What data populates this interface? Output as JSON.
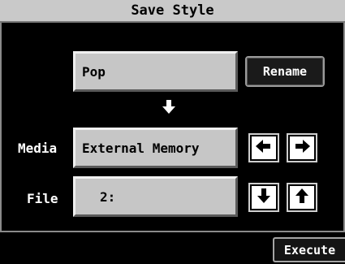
{
  "header": {
    "title": "Save Style"
  },
  "style_name": {
    "value": "Pop"
  },
  "rename_button": {
    "label": "Rename"
  },
  "media": {
    "label": "Media",
    "value": "External Memory"
  },
  "file": {
    "label": "File",
    "value": "2:"
  },
  "footer": {
    "execute_label": "Execute"
  },
  "icons": {
    "down_indicator": "arrow-down",
    "media_prev": "arrow-left",
    "media_next": "arrow-right",
    "file_down": "arrow-down",
    "file_up": "arrow-up"
  },
  "colors": {
    "background": "#000000",
    "title_bar": "#c9c9c9",
    "field_fill": "#c6c6c6",
    "text_light": "#ffffff"
  }
}
